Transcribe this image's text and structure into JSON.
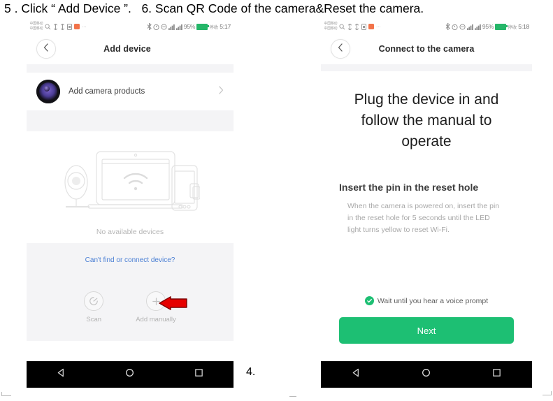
{
  "caption": {
    "text": "5 . Click “ Add Device ”.   6. Scan QR Code of the camera&Reset the camera."
  },
  "mid_note": {
    "text": "4."
  },
  "phone_left": {
    "status_bar": {
      "carrier_line1": "中国移动",
      "carrier_line2": "中国移动",
      "more_dots": "···",
      "battery_percent": "95%",
      "network_label": "停收",
      "time": "5:17",
      "icons_left": [
        "search-icon",
        "arrow-updown-icon",
        "arrow-updown-icon",
        "sim-card-icon",
        "orange-app-icon"
      ],
      "icons_right": [
        "bluetooth-icon",
        "alarm-icon",
        "dnd-icon",
        "signal-bars-icon",
        "signal-bars-icon",
        "battery-icon"
      ]
    },
    "navbar": {
      "back_icon": "chevron-left-icon",
      "title": "Add device"
    },
    "camera_row": {
      "icon": "camera-lens-icon",
      "label": "Add camera products",
      "chevron": "chevron-right-icon"
    },
    "illustration": {
      "name": "devices-wifi-illustration",
      "wifi_icon": "wifi-icon"
    },
    "empty_state": "No available devices",
    "help_link": "Can't find or connect device?",
    "actions": [
      {
        "icon": "scan-icon",
        "label": "Scan"
      },
      {
        "icon": "plus-icon",
        "label": "Add manually"
      }
    ],
    "annotation": {
      "name": "red-arrow-annotation",
      "color": "#d80000",
      "points_to": "Add manually"
    },
    "android_nav": [
      "back-triangle-icon",
      "home-circle-icon",
      "recents-square-icon"
    ]
  },
  "phone_right": {
    "status_bar": {
      "carrier_line1": "中国移动",
      "carrier_line2": "中国移动",
      "more_dots": "···",
      "battery_percent": "95%",
      "network_label": "停收",
      "time": "5:18",
      "icons_left": [
        "search-icon",
        "arrow-updown-icon",
        "arrow-updown-icon",
        "sim-card-icon",
        "orange-app-icon"
      ],
      "icons_right": [
        "bluetooth-icon",
        "alarm-icon",
        "dnd-icon",
        "signal-bars-icon",
        "signal-bars-icon",
        "battery-icon"
      ]
    },
    "navbar": {
      "back_icon": "chevron-left-icon",
      "title": "Connect to the camera"
    },
    "headline": "Plug the device in and follow the manual to operate",
    "section_title": "Insert the pin in the reset hole",
    "section_body": "When the camera is powered on, insert the pin in the reset hole for 5 seconds until the LED light turns yellow to reset Wi-Fi.",
    "voice_prompt": {
      "icon": "check-circle-icon",
      "text": "Wait until you hear a voice prompt"
    },
    "next_button": {
      "label": "Next",
      "color": "#1dbf73"
    },
    "android_nav": [
      "back-triangle-icon",
      "home-circle-icon",
      "recents-square-icon"
    ]
  }
}
